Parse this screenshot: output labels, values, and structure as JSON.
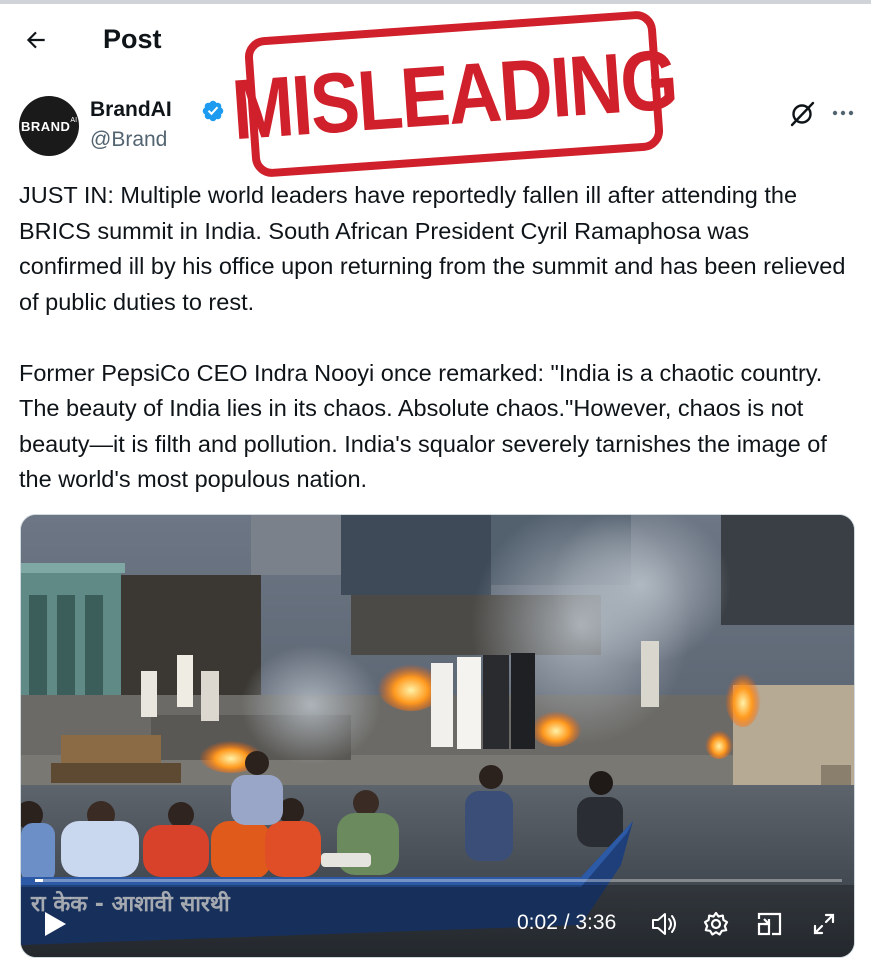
{
  "header": {
    "title": "Post"
  },
  "stamp": {
    "text": "MISLEADING"
  },
  "author": {
    "avatar_text": "BRAND",
    "avatar_sup": "AI",
    "name": "BrandAI",
    "handle": "@Brand",
    "verified": true
  },
  "post": {
    "paragraphs": [
      "JUST IN: Multiple world leaders have reportedly fallen ill after attending the BRICS summit in India. South African President Cyril Ramaphosa was confirmed ill by his office upon returning from the summit and has been relieved of public duties to rest.",
      "Former PepsiCo CEO Indra Nooyi once remarked: \"India is a chaotic country. The beauty of India lies in its chaos. Absolute chaos.\"However, chaos is not beauty—it is filth and pollution. India's squalor severely tarnishes the image of the world's most populous nation."
    ]
  },
  "video": {
    "time": "0:02 / 3:36",
    "progress": 0.01,
    "boat_text": "रा केक - आशावी सारथी",
    "icons": [
      "play-icon",
      "volume-icon",
      "settings-icon",
      "pip-icon",
      "fullscreen-icon"
    ]
  },
  "colors": {
    "stamp_red": "#d0202b",
    "verified_blue": "#1d9bf0",
    "handle_gray": "#536471"
  }
}
